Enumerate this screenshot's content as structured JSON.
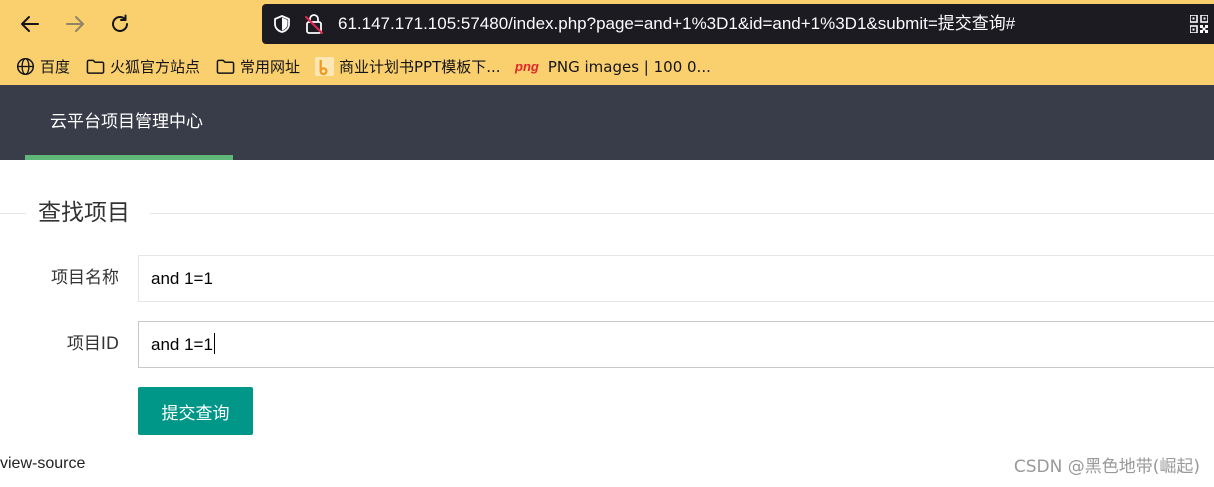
{
  "browser": {
    "url_host": "61.147.171.105",
    "url_rest": ":57480/index.php?page=and+1%3D1&id=and+1%3D1&submit=提交查询#",
    "bookmarks": [
      {
        "label": "百度",
        "icon": "globe-icon"
      },
      {
        "label": "火狐官方站点",
        "icon": "folder-icon"
      },
      {
        "label": "常用网址",
        "icon": "folder-icon"
      },
      {
        "label": "商业计划书PPT模板下...",
        "icon": "bookmark-b-icon"
      },
      {
        "label": "PNG images | 100 0...",
        "icon": "png-logo-icon",
        "icon_text": "png"
      }
    ]
  },
  "header": {
    "title": "云平台项目管理中心"
  },
  "form": {
    "legend": "查找项目",
    "name_label": "项目名称",
    "name_value": "and 1=1",
    "id_label": "项目ID",
    "id_value": "and 1=1",
    "submit_label": "提交查询"
  },
  "footer": {
    "view_source": "view-source",
    "watermark": "CSDN @黑色地带(崛起)"
  },
  "colors": {
    "browser_chrome": "#f9d06d",
    "urlbar": "#1c1b22",
    "header": "#393d49",
    "header_accent": "#5fb878",
    "submit_button": "#009688"
  }
}
